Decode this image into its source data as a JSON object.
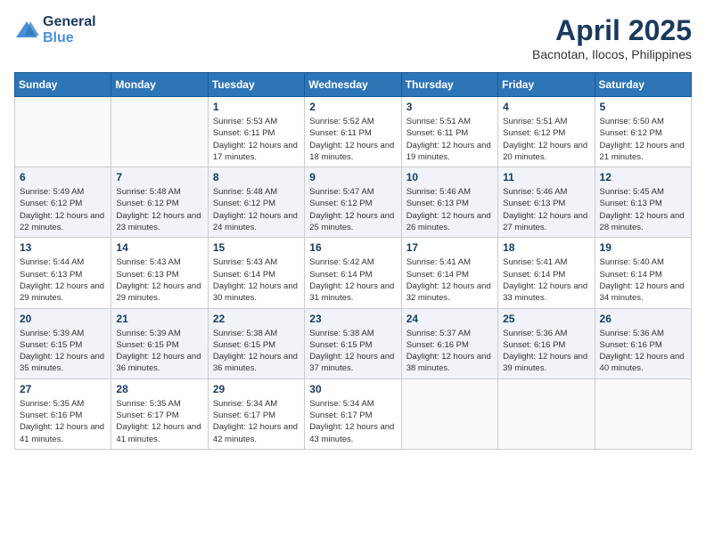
{
  "header": {
    "logo_line1": "General",
    "logo_line2": "Blue",
    "title": "April 2025",
    "subtitle": "Bacnotan, Ilocos, Philippines"
  },
  "weekdays": [
    "Sunday",
    "Monday",
    "Tuesday",
    "Wednesday",
    "Thursday",
    "Friday",
    "Saturday"
  ],
  "weeks": [
    [
      {
        "day": "",
        "sunrise": "",
        "sunset": "",
        "daylight": ""
      },
      {
        "day": "",
        "sunrise": "",
        "sunset": "",
        "daylight": ""
      },
      {
        "day": "1",
        "sunrise": "Sunrise: 5:53 AM",
        "sunset": "Sunset: 6:11 PM",
        "daylight": "Daylight: 12 hours and 17 minutes."
      },
      {
        "day": "2",
        "sunrise": "Sunrise: 5:52 AM",
        "sunset": "Sunset: 6:11 PM",
        "daylight": "Daylight: 12 hours and 18 minutes."
      },
      {
        "day": "3",
        "sunrise": "Sunrise: 5:51 AM",
        "sunset": "Sunset: 6:11 PM",
        "daylight": "Daylight: 12 hours and 19 minutes."
      },
      {
        "day": "4",
        "sunrise": "Sunrise: 5:51 AM",
        "sunset": "Sunset: 6:12 PM",
        "daylight": "Daylight: 12 hours and 20 minutes."
      },
      {
        "day": "5",
        "sunrise": "Sunrise: 5:50 AM",
        "sunset": "Sunset: 6:12 PM",
        "daylight": "Daylight: 12 hours and 21 minutes."
      }
    ],
    [
      {
        "day": "6",
        "sunrise": "Sunrise: 5:49 AM",
        "sunset": "Sunset: 6:12 PM",
        "daylight": "Daylight: 12 hours and 22 minutes."
      },
      {
        "day": "7",
        "sunrise": "Sunrise: 5:48 AM",
        "sunset": "Sunset: 6:12 PM",
        "daylight": "Daylight: 12 hours and 23 minutes."
      },
      {
        "day": "8",
        "sunrise": "Sunrise: 5:48 AM",
        "sunset": "Sunset: 6:12 PM",
        "daylight": "Daylight: 12 hours and 24 minutes."
      },
      {
        "day": "9",
        "sunrise": "Sunrise: 5:47 AM",
        "sunset": "Sunset: 6:12 PM",
        "daylight": "Daylight: 12 hours and 25 minutes."
      },
      {
        "day": "10",
        "sunrise": "Sunrise: 5:46 AM",
        "sunset": "Sunset: 6:13 PM",
        "daylight": "Daylight: 12 hours and 26 minutes."
      },
      {
        "day": "11",
        "sunrise": "Sunrise: 5:46 AM",
        "sunset": "Sunset: 6:13 PM",
        "daylight": "Daylight: 12 hours and 27 minutes."
      },
      {
        "day": "12",
        "sunrise": "Sunrise: 5:45 AM",
        "sunset": "Sunset: 6:13 PM",
        "daylight": "Daylight: 12 hours and 28 minutes."
      }
    ],
    [
      {
        "day": "13",
        "sunrise": "Sunrise: 5:44 AM",
        "sunset": "Sunset: 6:13 PM",
        "daylight": "Daylight: 12 hours and 29 minutes."
      },
      {
        "day": "14",
        "sunrise": "Sunrise: 5:43 AM",
        "sunset": "Sunset: 6:13 PM",
        "daylight": "Daylight: 12 hours and 29 minutes."
      },
      {
        "day": "15",
        "sunrise": "Sunrise: 5:43 AM",
        "sunset": "Sunset: 6:14 PM",
        "daylight": "Daylight: 12 hours and 30 minutes."
      },
      {
        "day": "16",
        "sunrise": "Sunrise: 5:42 AM",
        "sunset": "Sunset: 6:14 PM",
        "daylight": "Daylight: 12 hours and 31 minutes."
      },
      {
        "day": "17",
        "sunrise": "Sunrise: 5:41 AM",
        "sunset": "Sunset: 6:14 PM",
        "daylight": "Daylight: 12 hours and 32 minutes."
      },
      {
        "day": "18",
        "sunrise": "Sunrise: 5:41 AM",
        "sunset": "Sunset: 6:14 PM",
        "daylight": "Daylight: 12 hours and 33 minutes."
      },
      {
        "day": "19",
        "sunrise": "Sunrise: 5:40 AM",
        "sunset": "Sunset: 6:14 PM",
        "daylight": "Daylight: 12 hours and 34 minutes."
      }
    ],
    [
      {
        "day": "20",
        "sunrise": "Sunrise: 5:39 AM",
        "sunset": "Sunset: 6:15 PM",
        "daylight": "Daylight: 12 hours and 35 minutes."
      },
      {
        "day": "21",
        "sunrise": "Sunrise: 5:39 AM",
        "sunset": "Sunset: 6:15 PM",
        "daylight": "Daylight: 12 hours and 36 minutes."
      },
      {
        "day": "22",
        "sunrise": "Sunrise: 5:38 AM",
        "sunset": "Sunset: 6:15 PM",
        "daylight": "Daylight: 12 hours and 36 minutes."
      },
      {
        "day": "23",
        "sunrise": "Sunrise: 5:38 AM",
        "sunset": "Sunset: 6:15 PM",
        "daylight": "Daylight: 12 hours and 37 minutes."
      },
      {
        "day": "24",
        "sunrise": "Sunrise: 5:37 AM",
        "sunset": "Sunset: 6:16 PM",
        "daylight": "Daylight: 12 hours and 38 minutes."
      },
      {
        "day": "25",
        "sunrise": "Sunrise: 5:36 AM",
        "sunset": "Sunset: 6:16 PM",
        "daylight": "Daylight: 12 hours and 39 minutes."
      },
      {
        "day": "26",
        "sunrise": "Sunrise: 5:36 AM",
        "sunset": "Sunset: 6:16 PM",
        "daylight": "Daylight: 12 hours and 40 minutes."
      }
    ],
    [
      {
        "day": "27",
        "sunrise": "Sunrise: 5:35 AM",
        "sunset": "Sunset: 6:16 PM",
        "daylight": "Daylight: 12 hours and 41 minutes."
      },
      {
        "day": "28",
        "sunrise": "Sunrise: 5:35 AM",
        "sunset": "Sunset: 6:17 PM",
        "daylight": "Daylight: 12 hours and 41 minutes."
      },
      {
        "day": "29",
        "sunrise": "Sunrise: 5:34 AM",
        "sunset": "Sunset: 6:17 PM",
        "daylight": "Daylight: 12 hours and 42 minutes."
      },
      {
        "day": "30",
        "sunrise": "Sunrise: 5:34 AM",
        "sunset": "Sunset: 6:17 PM",
        "daylight": "Daylight: 12 hours and 43 minutes."
      },
      {
        "day": "",
        "sunrise": "",
        "sunset": "",
        "daylight": ""
      },
      {
        "day": "",
        "sunrise": "",
        "sunset": "",
        "daylight": ""
      },
      {
        "day": "",
        "sunrise": "",
        "sunset": "",
        "daylight": ""
      }
    ]
  ]
}
